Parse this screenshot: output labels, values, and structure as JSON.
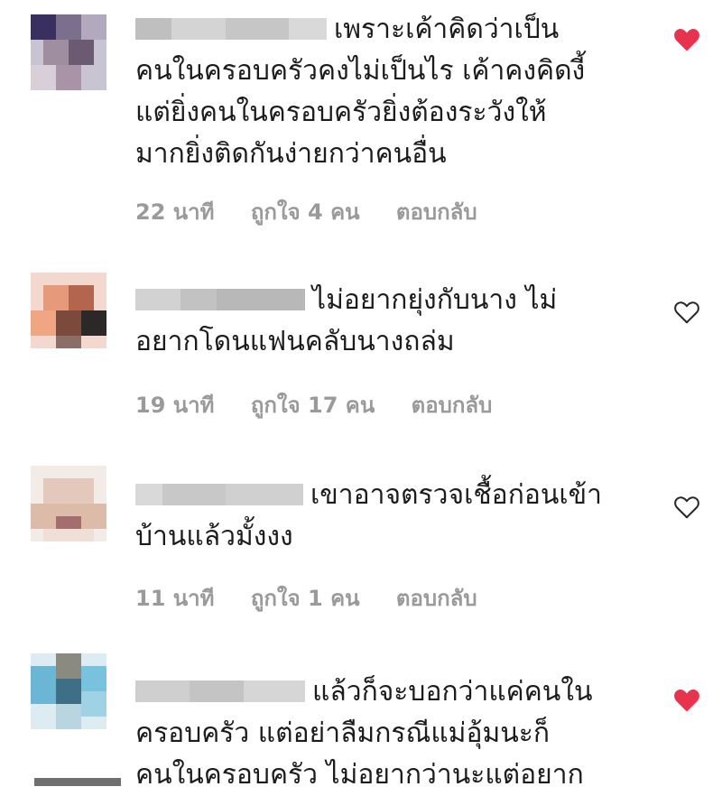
{
  "comments": [
    {
      "first_line": "เพราะเค้าคิดว่าเป็น",
      "lines": [
        "คนในครอบครัวคงไม่เป็นไร เค้าคงคิดงี้",
        "แต่ยิ่งคนในครอบครัวยิ่งต้องระวังให้",
        "มากยิ่งติดกันง่ายกว่าคนอื่น"
      ],
      "time": "22 นาที",
      "likes": "ถูกใจ 4 คน",
      "reply": "ตอบกลับ",
      "liked": true
    },
    {
      "first_line": "ไม่อยากยุ่งกับนาง ไม่",
      "lines": [
        "อยากโดนแฟนคลับนางถล่ม"
      ],
      "time": "19 นาที",
      "likes": "ถูกใจ 17 คน",
      "reply": "ตอบกลับ",
      "liked": false
    },
    {
      "first_line": "เขาอาจตรวจเชื้อก่อนเข้า",
      "lines": [
        "บ้านแล้วมั้งงง"
      ],
      "time": "11 นาที",
      "likes": "ถูกใจ 1 คน",
      "reply": "ตอบกลับ",
      "liked": false
    },
    {
      "first_line": "แล้วก็จะบอกว่าแค่คนใน",
      "lines": [
        "ครอบครัว แต่อย่าลืมกรณีแม่อุ้มนะก็",
        "คนในครอบครัว ไม่อยากว่านะแต่อยาก"
      ],
      "time": "",
      "likes": "",
      "reply": "",
      "liked": true
    }
  ],
  "colors": {
    "heart_liked": "#e8334f",
    "heart_outline": "#262626",
    "meta_text": "#9a9a9a"
  }
}
